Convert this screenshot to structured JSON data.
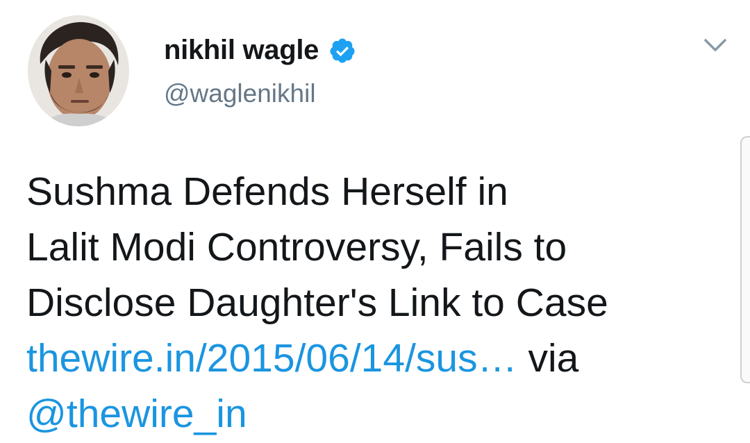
{
  "tweet": {
    "author": {
      "display_name": "nikhil wagle",
      "handle": "@waglenikhil",
      "verified": true,
      "avatar_icon": "user-photo"
    },
    "menu_icon": "chevron-down-icon",
    "text": {
      "line1": "Sushma Defends Herself in",
      "line2": "Lalit Modi Controversy, Fails to",
      "line3": "Disclose Daughter's Link to Case",
      "link": "thewire.in/2015/06/14/sus…",
      "via": " via",
      "mention": "@thewire_in"
    }
  },
  "colors": {
    "link": "#1b95e0",
    "text": "#14171a",
    "secondary": "#657786",
    "verified": "#1da1f2"
  }
}
